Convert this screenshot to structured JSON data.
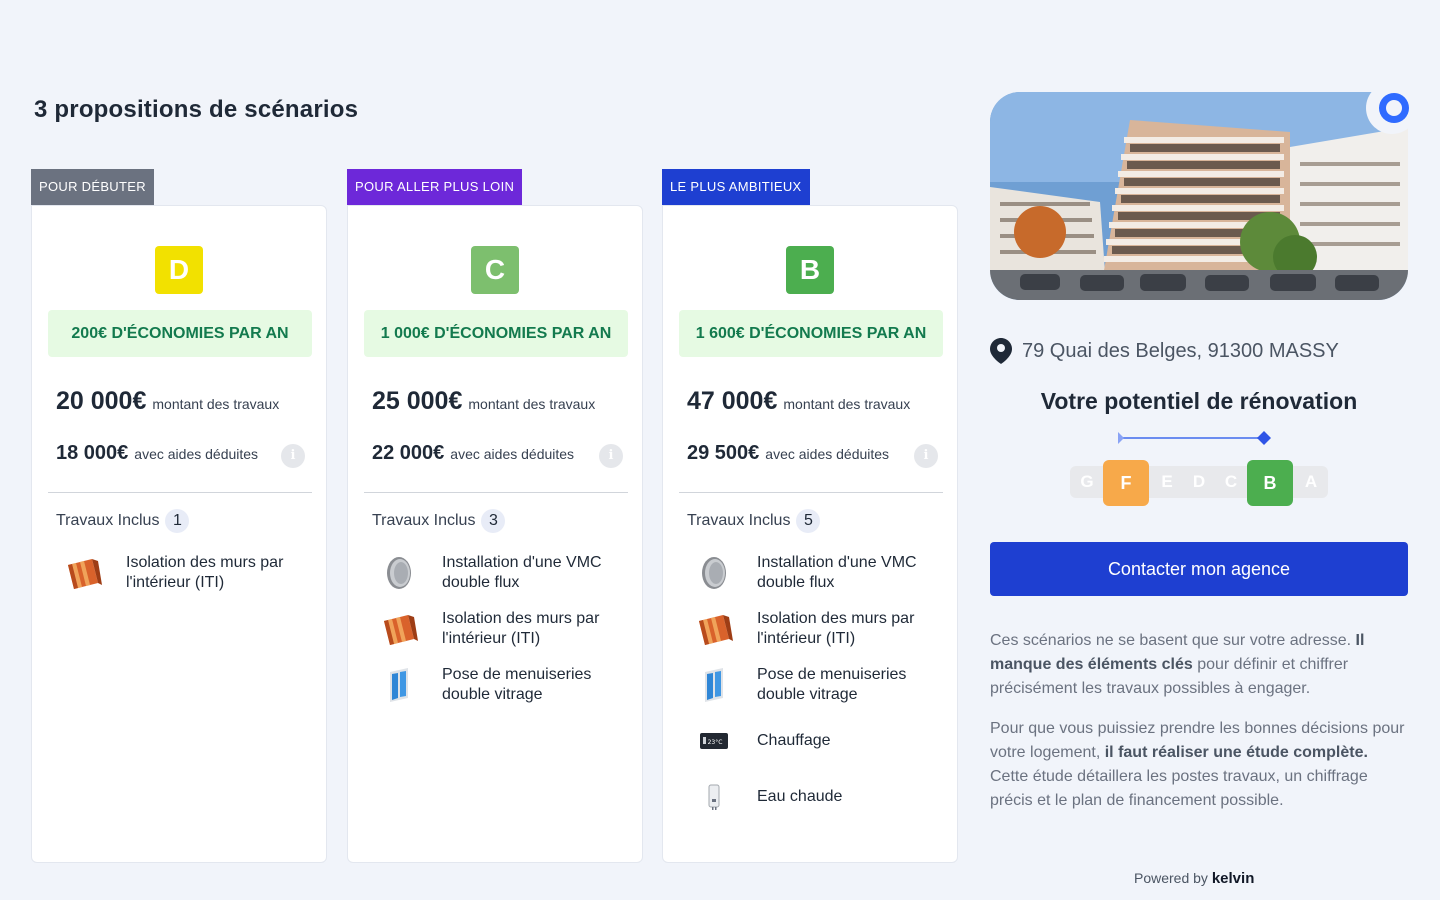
{
  "page": {
    "title": "3 propositions de scénarios"
  },
  "colors": {
    "accent": "#1e3fd1",
    "savings_bg": "#e6fae3",
    "savings_text": "#137a4e"
  },
  "scenarios": [
    {
      "tag": "POUR DÉBUTER",
      "tag_color": "#6b7280",
      "grade": "D",
      "grade_color": "#f2e100",
      "savings": "200€ D'ÉCONOMIES PAR AN",
      "amount": "20 000€",
      "amount_label": "montant des travaux",
      "after_aid": "18 000€",
      "after_aid_label": "avec aides déduites",
      "included_label": "Travaux Inclus",
      "included_count": "1",
      "works": [
        {
          "label": "Isolation des murs par l'intérieur (ITI)",
          "icon": "insulation-icon"
        }
      ]
    },
    {
      "tag": "POUR ALLER PLUS LOIN",
      "tag_color": "#6d28d9",
      "grade": "C",
      "grade_color": "#7dbf6e",
      "savings": "1 000€ D'ÉCONOMIES PAR AN",
      "amount": "25 000€",
      "amount_label": "montant des travaux",
      "after_aid": "22 000€",
      "after_aid_label": "avec aides déduites",
      "included_label": "Travaux Inclus",
      "included_count": "3",
      "works": [
        {
          "label": "Installation d'une VMC double flux",
          "icon": "vmc-icon"
        },
        {
          "label": "Isolation des murs par l'intérieur (ITI)",
          "icon": "insulation-icon"
        },
        {
          "label": "Pose de menuiseries double vitrage",
          "icon": "window-icon"
        }
      ]
    },
    {
      "tag": "LE PLUS AMBITIEUX",
      "tag_color": "#1e3fd1",
      "grade": "B",
      "grade_color": "#4cae4f",
      "savings": "1 600€ D'ÉCONOMIES PAR AN",
      "amount": "47 000€",
      "amount_label": "montant des travaux",
      "after_aid": "29 500€",
      "after_aid_label": "avec aides déduites",
      "included_label": "Travaux Inclus",
      "included_count": "5",
      "works": [
        {
          "label": "Installation d'une VMC double flux",
          "icon": "vmc-icon"
        },
        {
          "label": "Isolation des murs par l'intérieur (ITI)",
          "icon": "insulation-icon"
        },
        {
          "label": "Pose de menuiseries double vitrage",
          "icon": "window-icon"
        },
        {
          "label": "Chauffage",
          "icon": "thermostat-icon",
          "thermostat_text": "23°C"
        },
        {
          "label": "Eau chaude",
          "icon": "water-heater-icon"
        }
      ]
    }
  ],
  "property": {
    "address": "79 Quai des Belges, 91300 MASSY",
    "potential_title": "Votre potentiel de rénovation",
    "scale": [
      "G",
      "F",
      "E",
      "D",
      "C",
      "B",
      "A"
    ],
    "current_grade": "F",
    "current_color": "#f7a94a",
    "target_grade": "B",
    "target_color": "#4cae4f"
  },
  "cta": {
    "label": "Contacter mon agence"
  },
  "disclaimer": {
    "p1_start": "Ces scénarios ne se basent que sur votre adresse. ",
    "p1_bold": "Il manque des éléments clés",
    "p1_end": " pour définir et chiffrer précisément les travaux possibles à engager.",
    "p2_start": "Pour que vous puissiez prendre les bonnes décisions pour votre logement, ",
    "p2_bold": "il faut réaliser une étude complète.",
    "p2_end": "Cette étude détaillera les postes travaux, un chiffrage précis et le plan de financement possible."
  },
  "footer": {
    "powered_by": "Powered by",
    "brand": "kelvin"
  }
}
